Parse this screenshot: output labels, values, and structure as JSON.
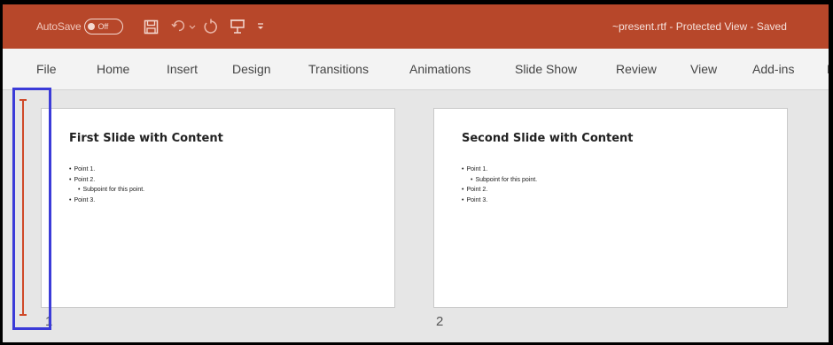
{
  "titlebar": {
    "autosave_label": "AutoSave",
    "autosave_state": "Off",
    "doc_title": "~present.rtf  -  Protected View  -  Saved",
    "icons": [
      "save-icon",
      "undo-icon",
      "redo-icon",
      "present-icon",
      "customize-qat-icon"
    ]
  },
  "ribbon": {
    "tabs": [
      "File",
      "Home",
      "Insert",
      "Design",
      "Transitions",
      "Animations",
      "Slide Show",
      "Review",
      "View",
      "Add-ins",
      "H"
    ]
  },
  "slides": [
    {
      "number": "1",
      "title": "First Slide with Content",
      "bullets": [
        {
          "text": "Point 1.",
          "level": 1
        },
        {
          "text": "Point 2.",
          "level": 1
        },
        {
          "text": "Subpoint for this point.",
          "level": 2
        },
        {
          "text": "Point 3.",
          "level": 1
        }
      ]
    },
    {
      "number": "2",
      "title": "Second Slide with Content",
      "bullets": [
        {
          "text": "Point 1.",
          "level": 1
        },
        {
          "text": "Subpoint for this point.",
          "level": 2
        },
        {
          "text": "Point 2.",
          "level": 1
        },
        {
          "text": "Point 3.",
          "level": 1
        }
      ]
    }
  ],
  "colors": {
    "titlebar": "#b7472a",
    "selection_box": "#3b3bd8",
    "insertion_marker": "#d04a2a"
  }
}
